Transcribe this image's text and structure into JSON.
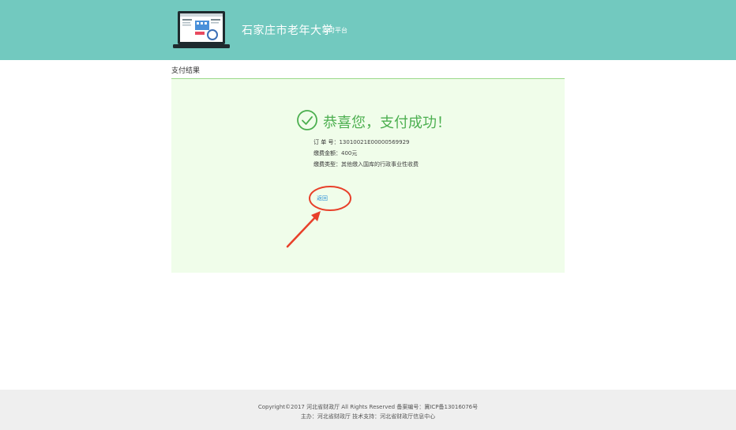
{
  "header": {
    "title": "石家庄市老年大学",
    "subtitle": "支付平台",
    "logo_icon": "laptop-icon"
  },
  "section": {
    "title": "支付结果"
  },
  "result": {
    "status_icon": "check-circle-icon",
    "message": "恭喜您，支付成功！",
    "order_label": "订 单 号：",
    "order_value": "13010021E00000569929",
    "amount_label": "缴费金额：",
    "amount_value": "400元",
    "type_label": "缴费类型：",
    "type_value": "其他缴入国库的行政事业性收费",
    "return_label": "返回",
    "success_color": "#4caf50"
  },
  "annotation": {
    "color": "#e8402a"
  },
  "footer": {
    "line1": "Copyright©2017 河北省财政厅 All Rights Reserved 备案编号：冀ICP备13016076号",
    "line2": "主办：河北省财政厅 技术支持：河北省财政厅信息中心"
  }
}
